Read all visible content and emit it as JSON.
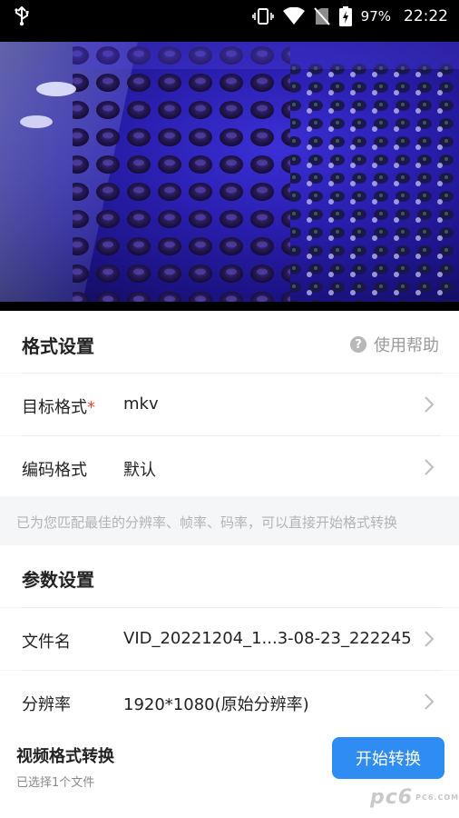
{
  "status_bar": {
    "battery_percent": "97%",
    "time": "22:22",
    "icons": [
      "usb-icon",
      "vibrate-icon",
      "wifi-icon",
      "no-sim-icon",
      "battery-charging-icon"
    ]
  },
  "format_settings": {
    "title": "格式设置",
    "help_label": "使用帮助",
    "target_format": {
      "label": "目标格式",
      "required_mark": "*",
      "value": "mkv"
    },
    "encoding_format": {
      "label": "编码格式",
      "value": "默认"
    }
  },
  "hint_text": "已为您匹配最佳的分辨率、帧率、码率，可以直接开始格式转换",
  "param_settings": {
    "title": "参数设置",
    "file_name": {
      "label": "文件名",
      "value": "VID_20221204_1...3-08-23_222245"
    },
    "resolution": {
      "label": "分辨率",
      "value": "1920*1080(原始分辨率)"
    }
  },
  "bottom_bar": {
    "title": "视频格式转换",
    "subtitle": "已选择1个文件",
    "start_label": "开始转换"
  },
  "watermark": {
    "text": "pc6",
    "small": "PC6.COM"
  },
  "colors": {
    "accent": "#2f8cf3",
    "required": "#e24a3b",
    "video_tint": "#2a1fb0"
  }
}
